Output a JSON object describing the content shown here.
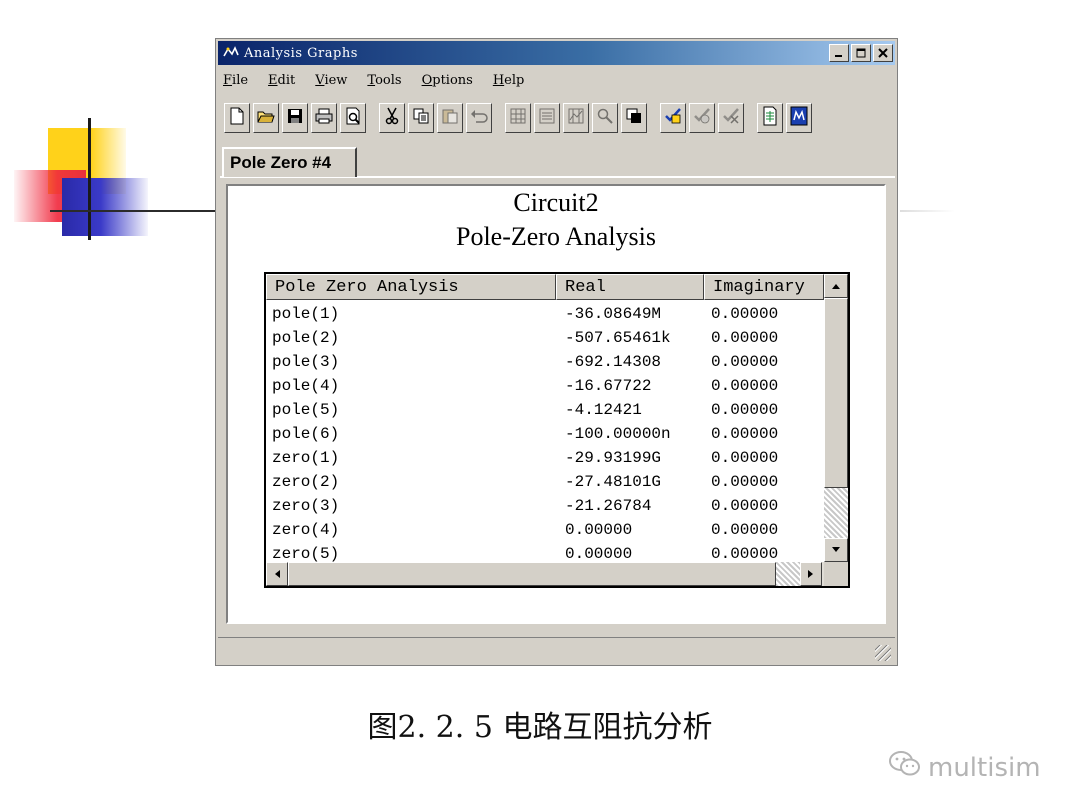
{
  "window": {
    "title": "Analysis Graphs",
    "controls": {
      "minimize": "_",
      "maximize": "□",
      "close": "×"
    }
  },
  "menu": [
    {
      "label": "File",
      "mnemonic": "F",
      "rest": "ile"
    },
    {
      "label": "Edit",
      "mnemonic": "E",
      "rest": "dit"
    },
    {
      "label": "View",
      "mnemonic": "V",
      "rest": "iew"
    },
    {
      "label": "Tools",
      "mnemonic": "T",
      "rest": "ools"
    },
    {
      "label": "Options",
      "mnemonic": "O",
      "rest": "ptions"
    },
    {
      "label": "Help",
      "mnemonic": "H",
      "rest": "elp"
    }
  ],
  "toolbar": {
    "icons": [
      "new-icon",
      "open-icon",
      "save-icon",
      "print-icon",
      "print-preview-icon",
      "cut-icon",
      "copy-icon",
      "paste-icon",
      "undo-icon",
      "grid-icon",
      "legend-icon",
      "cursors-icon",
      "zoom-icon",
      "reverse-colors-icon",
      "add-traces-icon",
      "overlay-traces-icon",
      "exclude-traces-icon",
      "export-excel-icon",
      "export-mathcad-icon"
    ]
  },
  "tab": {
    "label": "Pole Zero #4"
  },
  "analysis": {
    "title_line1": "Circuit2",
    "title_line2": "Pole-Zero Analysis",
    "columns": [
      "Pole Zero Analysis",
      "Real",
      "Imaginary"
    ],
    "rows": [
      [
        "pole(1)",
        "-36.08649M",
        "0.00000"
      ],
      [
        "pole(2)",
        "-507.65461k",
        "0.00000"
      ],
      [
        "pole(3)",
        "-692.14308",
        "0.00000"
      ],
      [
        "pole(4)",
        "-16.67722",
        "0.00000"
      ],
      [
        "pole(5)",
        "-4.12421",
        "0.00000"
      ],
      [
        "pole(6)",
        "-100.00000n",
        "0.00000"
      ],
      [
        "zero(1)",
        "-29.93199G",
        "0.00000"
      ],
      [
        "zero(2)",
        "-27.48101G",
        "0.00000"
      ],
      [
        "zero(3)",
        "-21.26784",
        "0.00000"
      ],
      [
        "zero(4)",
        "0.00000",
        "0.00000"
      ],
      [
        "zero(5)",
        "0.00000",
        "0.00000"
      ]
    ]
  },
  "caption": "图2. 2. 5  电路互阻抗分析",
  "watermark": "multisim",
  "colors": {
    "titlebar_start": "#0a246a",
    "titlebar_end": "#a6caf0",
    "face": "#d4d0c8"
  }
}
